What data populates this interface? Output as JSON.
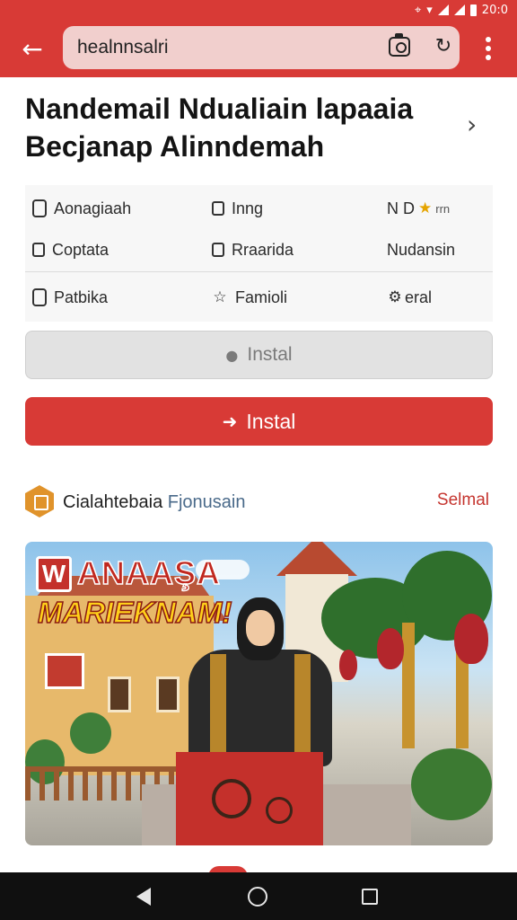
{
  "status_bar": {
    "time": "20:0"
  },
  "app_bar": {
    "url_text": "healnnsalri",
    "icons": [
      "back-arrow-icon",
      "camera-icon",
      "refresh-icon",
      "overflow-menu-icon"
    ]
  },
  "page": {
    "title": "Nandemail Ndualiain lapaaia Becjanap Alinndemah"
  },
  "info_grid": {
    "row1": [
      {
        "icon": "checkbox-icon",
        "label": "Aonagiaah"
      },
      {
        "icon": "square-minus-icon",
        "label": "Inng"
      },
      {
        "icon": "star-icon",
        "label": "N  D",
        "sublabel": "rrn"
      }
    ],
    "row2": [
      {
        "icon": "lock-icon",
        "label": "Coptata"
      },
      {
        "icon": "edit-icon",
        "label": "Rraarida"
      },
      {
        "label": "Nudansin"
      }
    ],
    "row3": [
      {
        "icon": "bag-icon",
        "label": "Patbika"
      },
      {
        "icon": "sparkle-star-icon",
        "label": "Famioli"
      },
      {
        "icon": "gear-icon",
        "label": "eral"
      }
    ]
  },
  "buttons": {
    "secondary_install": "Instal",
    "primary_install": "Instal"
  },
  "section": {
    "title_main": "Cialahtebaia",
    "title_accent": "Fjonusain",
    "link": "Selmal"
  },
  "banner": {
    "logo_letter": "W",
    "line1": "ANAAŞA",
    "line2": "MARIEKNAM!"
  },
  "colors": {
    "brand_red": "#d83a36",
    "url_bar": "#f1cfcd",
    "section_icon": "#e0932b",
    "link_red": "#c5352f",
    "nav_bar": "#101010"
  }
}
